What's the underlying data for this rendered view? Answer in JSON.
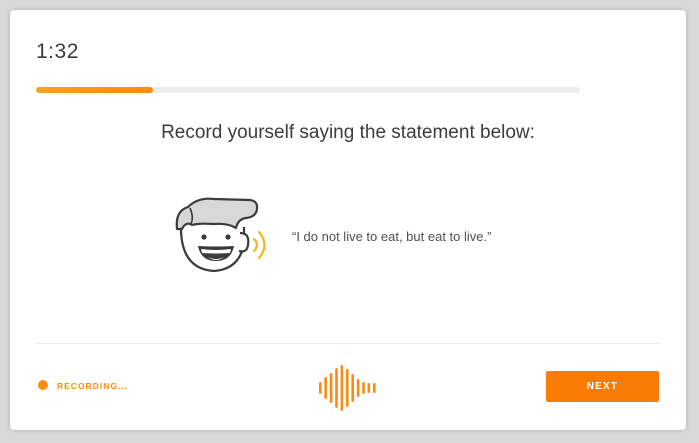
{
  "timer": {
    "text": "1:32"
  },
  "progress": {
    "value_fraction": 0.215
  },
  "prompt": {
    "instruction": "Record yourself saying the statement below:"
  },
  "statement": {
    "text": "“I do not live to eat, but eat to live.”"
  },
  "status": {
    "label": "RECORDING..."
  },
  "actions": {
    "next_label": "NEXT"
  },
  "icons": {
    "character": "speaking-person-icon",
    "waveform": "audio-waveform-icon",
    "recording": "recording-dot-icon"
  },
  "colors": {
    "accent": "#f98c15",
    "button": "#fa7c06",
    "text_primary": "#3c3c3c",
    "track": "#ececec"
  }
}
